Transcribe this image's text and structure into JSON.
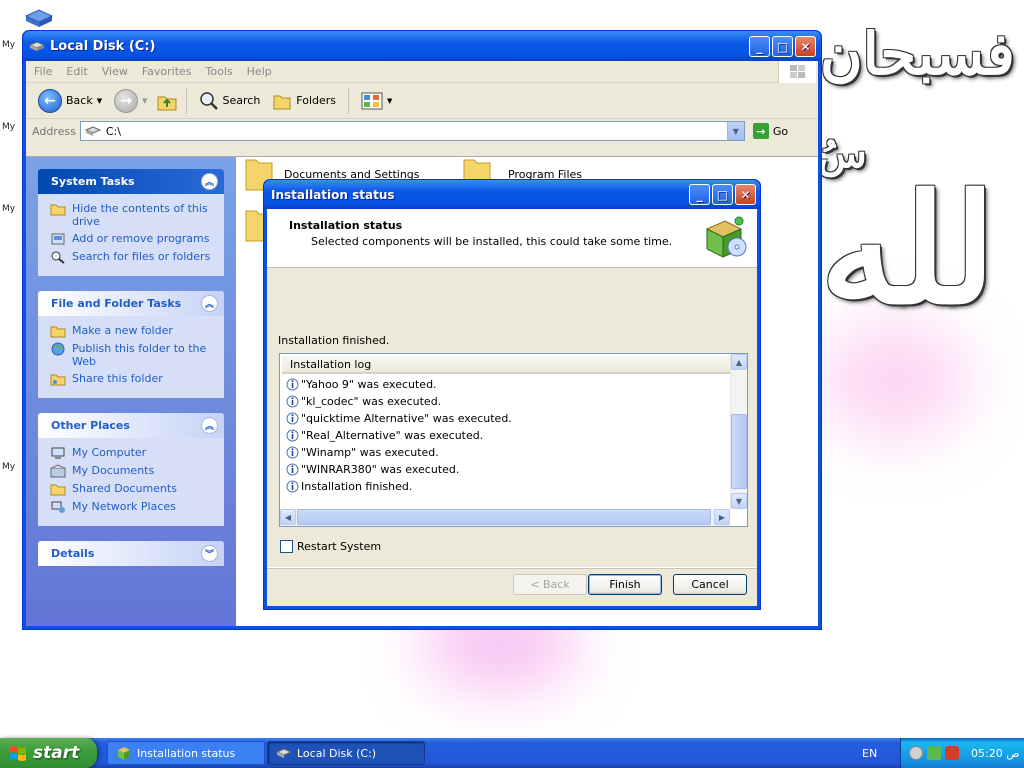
{
  "desktop": {
    "icon_labels": [
      "My",
      "My",
      "My",
      "My"
    ],
    "calligraphy": [
      "فسبحان",
      "سُ",
      "لله"
    ]
  },
  "explorer": {
    "title": "Local Disk (C:)",
    "menu": [
      "File",
      "Edit",
      "View",
      "Favorites",
      "Tools",
      "Help"
    ],
    "toolbar": {
      "back": "Back",
      "search": "Search",
      "folders": "Folders"
    },
    "address_label": "Address",
    "address_value": "C:\\",
    "go_label": "Go",
    "taskpane": {
      "system_tasks": {
        "title": "System Tasks",
        "items": [
          "Hide the contents of this drive",
          "Add or remove programs",
          "Search for files or folders"
        ]
      },
      "file_folder_tasks": {
        "title": "File and Folder Tasks",
        "items": [
          "Make a new folder",
          "Publish this folder to the Web",
          "Share this folder"
        ]
      },
      "other_places": {
        "title": "Other Places",
        "items": [
          "My Computer",
          "My Documents",
          "Shared Documents",
          "My Network Places"
        ]
      },
      "details": {
        "title": "Details"
      }
    },
    "folders": [
      "Documents and Settings",
      "Program Files"
    ]
  },
  "dialog": {
    "title": "Installation status",
    "header_title": "Installation status",
    "header_subtitle": "Selected components will be installed, this could take some time.",
    "status_text": "Installation finished.",
    "log_header": "Installation log",
    "log_entries": [
      "\"Yahoo 9\" was executed.",
      "\"kl_codec\" was executed.",
      "\"quicktime Alternative\" was executed.",
      "\"Real_Alternative\" was executed.",
      "\"Winamp\" was executed.",
      "\"WINRAR380\" was executed.",
      "Installation finished."
    ],
    "restart_label": "Restart System",
    "restart_checked": false,
    "buttons": {
      "back": "< Back",
      "finish": "Finish",
      "cancel": "Cancel"
    }
  },
  "taskbar": {
    "start": "start",
    "tasks": [
      "Installation status",
      "Local Disk (C:)"
    ],
    "language": "EN",
    "clock": "05:20 ص"
  },
  "colors": {
    "xp_blue": "#0a53e2",
    "taskpane_link": "#215dc6",
    "start_green": "#3c9f3c"
  }
}
